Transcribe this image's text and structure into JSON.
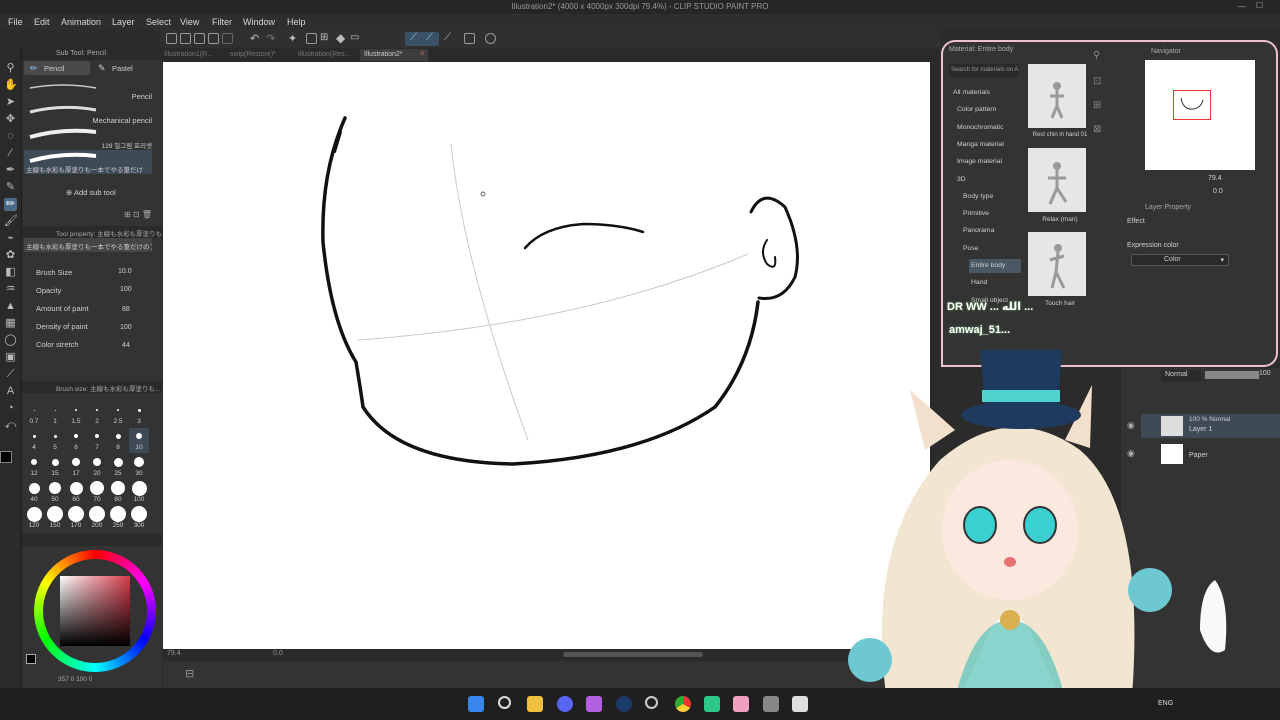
{
  "window": {
    "title": "Illustration2* (4000 x 4000px 300dpi 79.4%) - CLIP STUDIO PAINT PRO"
  },
  "menu": [
    "File",
    "Edit",
    "Animation",
    "Layer",
    "Select",
    "View",
    "Filter",
    "Window",
    "Help"
  ],
  "tabs": [
    "Illustration1(R...",
    "swip(Restore)*",
    "Illustration(Res...",
    "Illustration2*"
  ],
  "subtool": {
    "header": "Sub Tool: Pencil",
    "groups": [
      "Pencil",
      "Pastel"
    ],
    "items": [
      {
        "label": "Pencil"
      },
      {
        "label": "Mechanical pencil"
      },
      {
        "label": "129 밀그림 프리셋"
      },
      {
        "label": "主線も水彩も厚塗りも一本でやる筆だけ"
      }
    ],
    "add_label": "Add sub tool"
  },
  "tool_property": {
    "header": "Tool property: 主線も水彩も厚塗りも...",
    "preset_label": "主線も水彩も厚塗りも一本でやる筆だけのブラシ",
    "rows": [
      {
        "label": "Brush Size",
        "value": "10.0"
      },
      {
        "label": "Opacity",
        "value": "100"
      },
      {
        "label": "Amount of paint",
        "value": "88"
      },
      {
        "label": "Density of paint",
        "value": "100"
      },
      {
        "label": "Color stretch",
        "value": "44"
      }
    ]
  },
  "brush_size": {
    "header": "Brush size: 主線も水彩も厚塗りも...",
    "sizes": [
      "0.7",
      "1",
      "1.5",
      "2",
      "2.5",
      "3",
      "4",
      "5",
      "6",
      "7",
      "8",
      "10",
      "12",
      "15",
      "17",
      "20",
      "25",
      "30",
      "40",
      "50",
      "60",
      "70",
      "80",
      "100",
      "120",
      "150",
      "170",
      "200",
      "250",
      "300"
    ],
    "selected": "10"
  },
  "color": {
    "readout": "357  0  100  0",
    "accent": "#d44a5a",
    "wheel_hue_deg": 357
  },
  "canvas": {
    "zoom": "79.4",
    "rotation": "0.0"
  },
  "material": {
    "header": "Material: Entire body",
    "search_placeholder": "Search for materials on A...",
    "tree": [
      "All materials",
      "Color pattern",
      "Monochromatic",
      "Manga material",
      "Image material",
      "3D",
      "Body type",
      "Primitive",
      "Panorama",
      "Pose",
      "Entire body",
      "Hand",
      "Small object"
    ],
    "selected": "Entire body",
    "thumbs": [
      "Rest chin in hand 01",
      "Relax (man)",
      "Touch hair"
    ]
  },
  "navigator": {
    "header": "Navigator",
    "zoom": "79.4",
    "rotation": "0.0"
  },
  "layer_property": {
    "header": "Layer Property",
    "effect": "Effect",
    "expression_label": "Expression color",
    "expression_value": "Color"
  },
  "layers": {
    "blend_mode": "Normal",
    "opacity": "100",
    "items": [
      {
        "title": "100 % Normal",
        "name": "Layer 1",
        "selected": true
      },
      {
        "title": "",
        "name": "Paper",
        "selected": false
      }
    ]
  },
  "stream_overlay": {
    "chat_lines": [
      "DR WW  ... الله ...",
      "amwaj_51..."
    ]
  },
  "taskbar": {
    "icons": [
      "windows-start",
      "search",
      "file-explorer",
      "discord",
      "app",
      "steam",
      "settings",
      "chrome",
      "app-green",
      "app-pink",
      "app-gray",
      "csp"
    ],
    "lang": "ENG"
  }
}
